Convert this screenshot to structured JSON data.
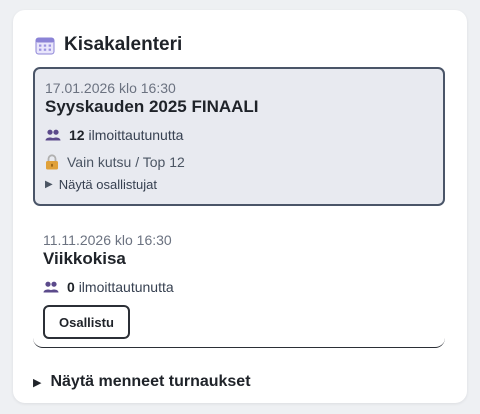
{
  "header": {
    "title": "Kisakalenteri",
    "icon": "calendar-icon"
  },
  "events": [
    {
      "date": "17.01.2026 klo 16:30",
      "title": "Syyskauden 2025 FINAALI",
      "registered_count": "12",
      "registered_label": "ilmoittautunutta",
      "restriction": "Vain kutsu / Top 12",
      "show_participants": "Näytä osallistujat"
    },
    {
      "date": "11.11.2026 klo 16:30",
      "title": "Viikkokisa",
      "registered_count": "0",
      "registered_label": "ilmoittautunutta",
      "join_button": "Osallistu"
    }
  ],
  "show_past": "Näytä menneet turnaukset",
  "colors": {
    "highlight_bg": "#e8eaf0",
    "highlight_border": "#4a5568",
    "users_icon": "#5b4a8b",
    "lock_icon": "#e0a13a"
  }
}
